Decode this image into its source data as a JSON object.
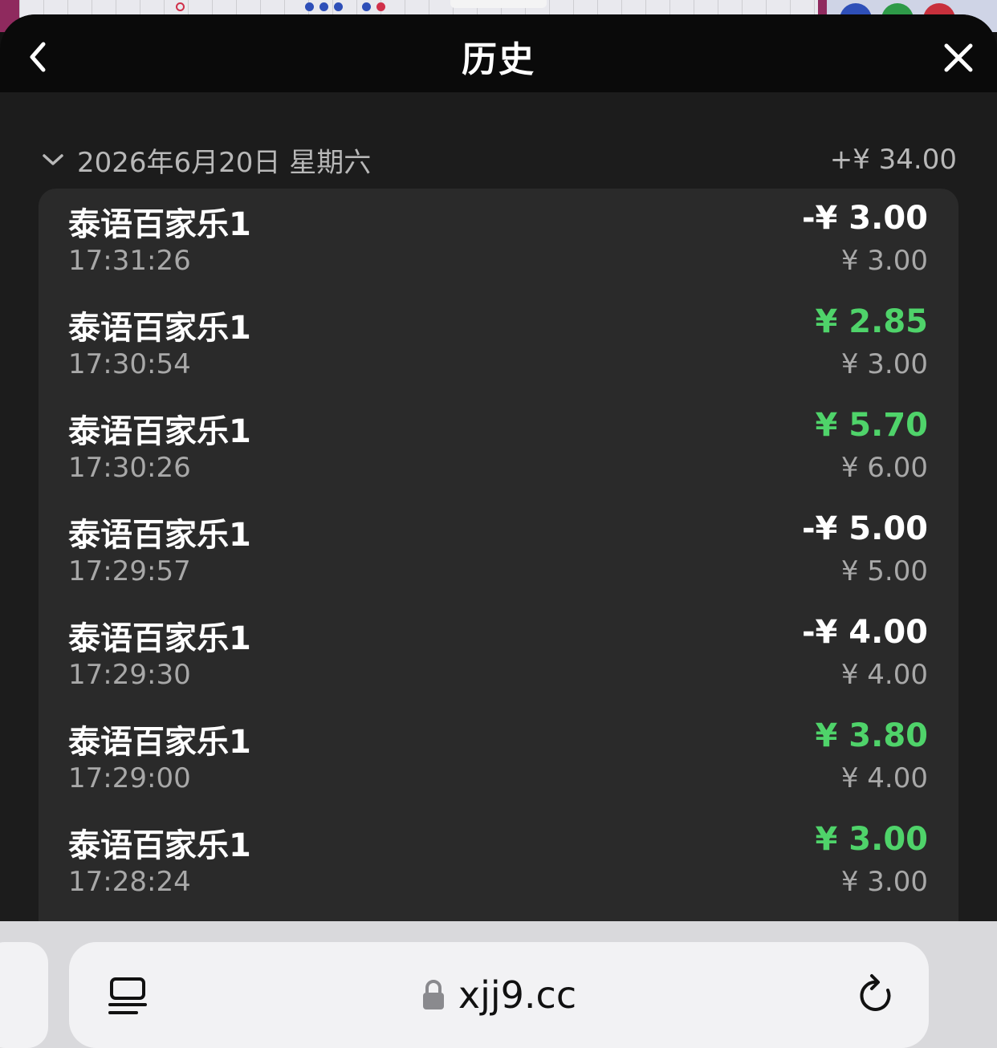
{
  "header": {
    "title": "历史"
  },
  "group": {
    "date": "2026年6月20日 星期六",
    "total": "+¥ 34.00"
  },
  "colors": {
    "win": "#4fd36a",
    "loss": "#ffffff",
    "muted": "#a8a8a8",
    "card": "#2a2a2a"
  },
  "items": [
    {
      "name": "泰语百家乐1",
      "time": "17:31:26",
      "amount": "-¥ 3.00",
      "stake": "¥ 3.00",
      "result": "loss"
    },
    {
      "name": "泰语百家乐1",
      "time": "17:30:54",
      "amount": "¥ 2.85",
      "stake": "¥ 3.00",
      "result": "win"
    },
    {
      "name": "泰语百家乐1",
      "time": "17:30:26",
      "amount": "¥ 5.70",
      "stake": "¥ 6.00",
      "result": "win"
    },
    {
      "name": "泰语百家乐1",
      "time": "17:29:57",
      "amount": "-¥ 5.00",
      "stake": "¥ 5.00",
      "result": "loss"
    },
    {
      "name": "泰语百家乐1",
      "time": "17:29:30",
      "amount": "-¥ 4.00",
      "stake": "¥ 4.00",
      "result": "loss"
    },
    {
      "name": "泰语百家乐1",
      "time": "17:29:00",
      "amount": "¥ 3.80",
      "stake": "¥ 4.00",
      "result": "win"
    },
    {
      "name": "泰语百家乐1",
      "time": "17:28:24",
      "amount": "¥ 3.00",
      "stake": "¥ 3.00",
      "result": "win"
    }
  ],
  "browser": {
    "url": "xjj9.cc"
  },
  "icons": {
    "back": "chevron-left-icon",
    "close": "close-icon",
    "collapse": "chevron-down-icon",
    "reader": "reader-view-icon",
    "lock": "lock-icon",
    "reload": "reload-icon"
  }
}
